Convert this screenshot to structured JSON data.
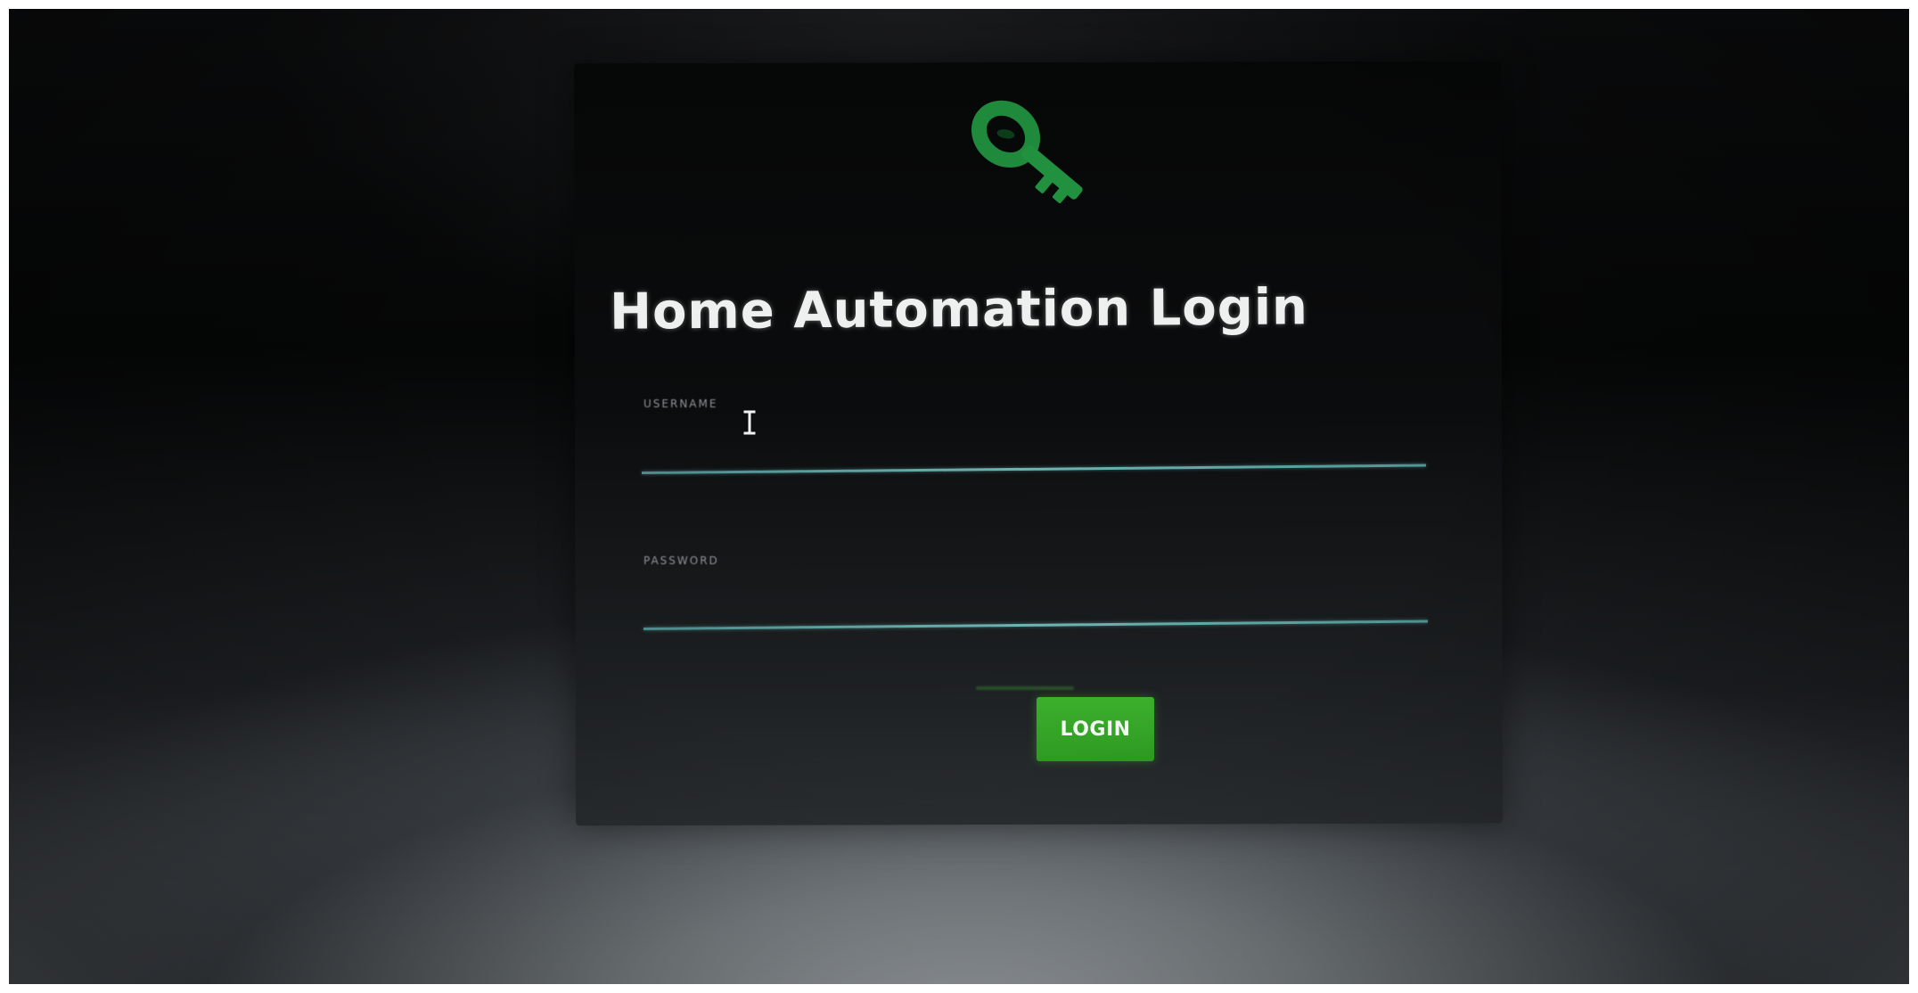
{
  "app": {
    "title": "Home Automation Login"
  },
  "logo": {
    "icon": "key-icon",
    "color": "#1f8a3c"
  },
  "form": {
    "username": {
      "label": "USERNAME",
      "value": "",
      "placeholder": ""
    },
    "password": {
      "label": "PASSWORD",
      "value": "",
      "placeholder": ""
    },
    "login_label": "LOGIN"
  },
  "colors": {
    "accent": "#2e9a22",
    "underline": "#5aa3a3",
    "title_text": "#eef0f0"
  },
  "cursor": {
    "icon": "text-cursor-icon"
  }
}
